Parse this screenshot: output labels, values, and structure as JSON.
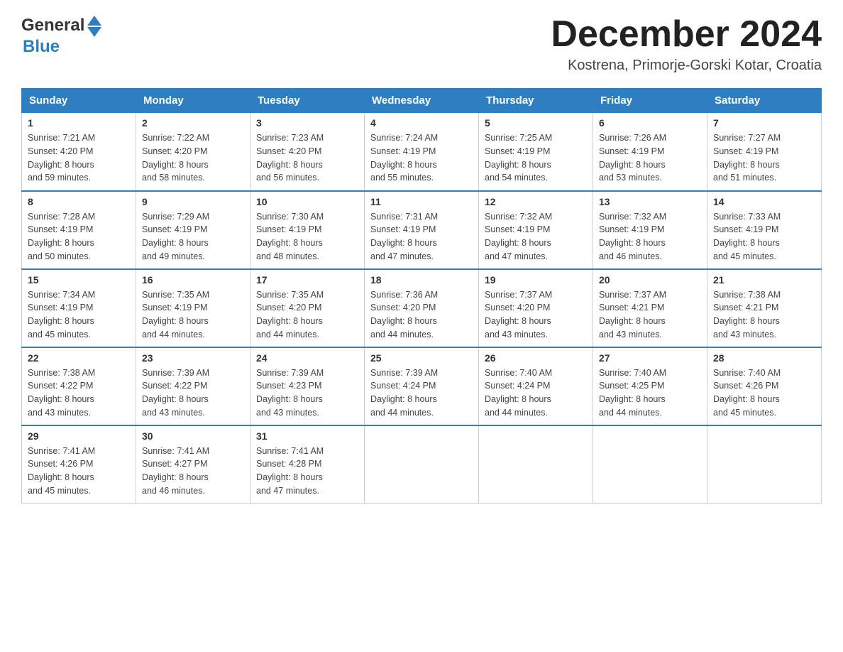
{
  "header": {
    "logo_general": "General",
    "logo_blue": "Blue",
    "month_title": "December 2024",
    "location": "Kostrena, Primorje-Gorski Kotar, Croatia"
  },
  "days_of_week": [
    "Sunday",
    "Monday",
    "Tuesday",
    "Wednesday",
    "Thursday",
    "Friday",
    "Saturday"
  ],
  "weeks": [
    [
      {
        "day": "1",
        "sunrise": "7:21 AM",
        "sunset": "4:20 PM",
        "daylight": "8 hours and 59 minutes."
      },
      {
        "day": "2",
        "sunrise": "7:22 AM",
        "sunset": "4:20 PM",
        "daylight": "8 hours and 58 minutes."
      },
      {
        "day": "3",
        "sunrise": "7:23 AM",
        "sunset": "4:20 PM",
        "daylight": "8 hours and 56 minutes."
      },
      {
        "day": "4",
        "sunrise": "7:24 AM",
        "sunset": "4:19 PM",
        "daylight": "8 hours and 55 minutes."
      },
      {
        "day": "5",
        "sunrise": "7:25 AM",
        "sunset": "4:19 PM",
        "daylight": "8 hours and 54 minutes."
      },
      {
        "day": "6",
        "sunrise": "7:26 AM",
        "sunset": "4:19 PM",
        "daylight": "8 hours and 53 minutes."
      },
      {
        "day": "7",
        "sunrise": "7:27 AM",
        "sunset": "4:19 PM",
        "daylight": "8 hours and 51 minutes."
      }
    ],
    [
      {
        "day": "8",
        "sunrise": "7:28 AM",
        "sunset": "4:19 PM",
        "daylight": "8 hours and 50 minutes."
      },
      {
        "day": "9",
        "sunrise": "7:29 AM",
        "sunset": "4:19 PM",
        "daylight": "8 hours and 49 minutes."
      },
      {
        "day": "10",
        "sunrise": "7:30 AM",
        "sunset": "4:19 PM",
        "daylight": "8 hours and 48 minutes."
      },
      {
        "day": "11",
        "sunrise": "7:31 AM",
        "sunset": "4:19 PM",
        "daylight": "8 hours and 47 minutes."
      },
      {
        "day": "12",
        "sunrise": "7:32 AM",
        "sunset": "4:19 PM",
        "daylight": "8 hours and 47 minutes."
      },
      {
        "day": "13",
        "sunrise": "7:32 AM",
        "sunset": "4:19 PM",
        "daylight": "8 hours and 46 minutes."
      },
      {
        "day": "14",
        "sunrise": "7:33 AM",
        "sunset": "4:19 PM",
        "daylight": "8 hours and 45 minutes."
      }
    ],
    [
      {
        "day": "15",
        "sunrise": "7:34 AM",
        "sunset": "4:19 PM",
        "daylight": "8 hours and 45 minutes."
      },
      {
        "day": "16",
        "sunrise": "7:35 AM",
        "sunset": "4:19 PM",
        "daylight": "8 hours and 44 minutes."
      },
      {
        "day": "17",
        "sunrise": "7:35 AM",
        "sunset": "4:20 PM",
        "daylight": "8 hours and 44 minutes."
      },
      {
        "day": "18",
        "sunrise": "7:36 AM",
        "sunset": "4:20 PM",
        "daylight": "8 hours and 44 minutes."
      },
      {
        "day": "19",
        "sunrise": "7:37 AM",
        "sunset": "4:20 PM",
        "daylight": "8 hours and 43 minutes."
      },
      {
        "day": "20",
        "sunrise": "7:37 AM",
        "sunset": "4:21 PM",
        "daylight": "8 hours and 43 minutes."
      },
      {
        "day": "21",
        "sunrise": "7:38 AM",
        "sunset": "4:21 PM",
        "daylight": "8 hours and 43 minutes."
      }
    ],
    [
      {
        "day": "22",
        "sunrise": "7:38 AM",
        "sunset": "4:22 PM",
        "daylight": "8 hours and 43 minutes."
      },
      {
        "day": "23",
        "sunrise": "7:39 AM",
        "sunset": "4:22 PM",
        "daylight": "8 hours and 43 minutes."
      },
      {
        "day": "24",
        "sunrise": "7:39 AM",
        "sunset": "4:23 PM",
        "daylight": "8 hours and 43 minutes."
      },
      {
        "day": "25",
        "sunrise": "7:39 AM",
        "sunset": "4:24 PM",
        "daylight": "8 hours and 44 minutes."
      },
      {
        "day": "26",
        "sunrise": "7:40 AM",
        "sunset": "4:24 PM",
        "daylight": "8 hours and 44 minutes."
      },
      {
        "day": "27",
        "sunrise": "7:40 AM",
        "sunset": "4:25 PM",
        "daylight": "8 hours and 44 minutes."
      },
      {
        "day": "28",
        "sunrise": "7:40 AM",
        "sunset": "4:26 PM",
        "daylight": "8 hours and 45 minutes."
      }
    ],
    [
      {
        "day": "29",
        "sunrise": "7:41 AM",
        "sunset": "4:26 PM",
        "daylight": "8 hours and 45 minutes."
      },
      {
        "day": "30",
        "sunrise": "7:41 AM",
        "sunset": "4:27 PM",
        "daylight": "8 hours and 46 minutes."
      },
      {
        "day": "31",
        "sunrise": "7:41 AM",
        "sunset": "4:28 PM",
        "daylight": "8 hours and 47 minutes."
      },
      null,
      null,
      null,
      null
    ]
  ],
  "labels": {
    "sunrise": "Sunrise:",
    "sunset": "Sunset:",
    "daylight": "Daylight:"
  }
}
